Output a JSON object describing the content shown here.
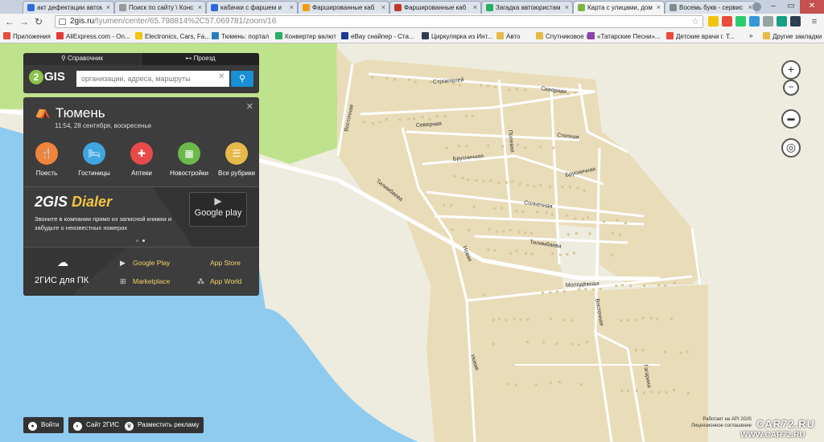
{
  "browser": {
    "tabs": [
      {
        "label": "акт дефектации автом",
        "fav_color": "#2d6bd6"
      },
      {
        "label": "Поиск по сайту \\ Конс",
        "fav_color": "#999999"
      },
      {
        "label": "кабачки с фаршем и",
        "fav_color": "#2d6bd6"
      },
      {
        "label": "Фаршированные каб",
        "fav_color": "#f39c12"
      },
      {
        "label": "Фаршированные каб",
        "fav_color": "#c0392b"
      },
      {
        "label": "Загадка автоюристам",
        "fav_color": "#27ae60"
      },
      {
        "label": "Карта с улицами, дом",
        "fav_color": "#7cb342"
      },
      {
        "label": "Восемь букв - сервис",
        "fav_color": "#7f8c8d"
      }
    ],
    "active_tab": 6,
    "url_host": "2gis.ru",
    "url_path": "/tyumen/center/65.798814%2C57.069781/zoom/16",
    "bookmarks": [
      {
        "label": "Приложения",
        "icon_color": "#e74c3c"
      },
      {
        "label": "AliExpress.com - On...",
        "icon_color": "#e53935"
      },
      {
        "label": "Electronics, Cars, Fa...",
        "icon_color": "#f1c40f"
      },
      {
        "label": "Тюмень: портал",
        "icon_color": "#2980b9"
      },
      {
        "label": "Конвертер валют",
        "icon_color": "#27ae60"
      },
      {
        "label": "eBay снайпер - Ста...",
        "icon_color": "#1e3799"
      },
      {
        "label": "Циркулярка из Инт...",
        "icon_color": "#2c3e50"
      },
      {
        "label": "Авто",
        "icon_color": "#e6b94a"
      },
      {
        "label": "Спутниковое тв",
        "icon_color": "#e6b94a"
      },
      {
        "label": "«Татарские Песни»...",
        "icon_color": "#8e44ad"
      },
      {
        "label": "Детские врачи г. Т...",
        "icon_color": "#e74c3c"
      },
      {
        "label": "Другие закладки",
        "icon_color": "#e6b94a"
      }
    ],
    "bookmarks_more": "»"
  },
  "panel": {
    "tab_directory": "Справочник",
    "tab_route": "Проезд",
    "logo_text": "GIS",
    "logo_digit": "2",
    "search_placeholder": "организации, адреса, маршруты",
    "city": "Тюмень",
    "datetime": "11:54, 28 сентября, воскресенье",
    "categories": [
      {
        "label": "Поесть",
        "icon": "fork-knife-icon",
        "color": "#f0843c",
        "glyph": "🍴"
      },
      {
        "label": "Гостиницы",
        "icon": "bed-icon",
        "color": "#3fa6e0",
        "glyph": "🛏"
      },
      {
        "label": "Аптеки",
        "icon": "cross-icon",
        "color": "#e84a4a",
        "glyph": "✚"
      },
      {
        "label": "Новостройки",
        "icon": "building-icon",
        "color": "#6cb84a",
        "glyph": "▦"
      },
      {
        "label": "Все рубрики",
        "icon": "list-icon",
        "color": "#e6b94a",
        "glyph": "☰"
      }
    ],
    "dialer_brand": "2GIS",
    "dialer_product": "Dialer",
    "dialer_text": "Звоните в компании прямо из записной книжки и забудьте о неизвестных номерах",
    "gplay_label": "Google play",
    "pc_label": "2ГИС для ПК",
    "stores": [
      {
        "label": "Google Play",
        "icon": "google-play-icon",
        "glyph": "▶"
      },
      {
        "label": "App Store",
        "icon": "apple-icon",
        "glyph": ""
      },
      {
        "label": "Marketplace",
        "icon": "windows-icon",
        "glyph": "⊞"
      },
      {
        "label": "App World",
        "icon": "blackberry-icon",
        "glyph": "⁂"
      }
    ]
  },
  "map": {
    "streets": [
      "Строителей",
      "Северная",
      "Северная",
      "Восточная",
      "Полевая",
      "Степная",
      "Брусничная",
      "Брусничная",
      "Солнечная",
      "Тилимбаева",
      "Тилимбаева",
      "Новая",
      "Новая",
      "Молодёжная",
      "Восточная",
      "Гагарина"
    ],
    "colors": {
      "water": "#8fcbee",
      "land": "#eeecde",
      "park": "#bfe28c",
      "village": "#e9dcb9",
      "road": "#ffffff"
    }
  },
  "controls": {
    "zoom_in": "+",
    "zoom_out": "−",
    "ruler": "▬",
    "locate": "◎"
  },
  "bottom": {
    "login": "Войти",
    "site": "Сайт 2ГИС",
    "ads": "Разместить рекламу"
  },
  "attribution": {
    "line1": "Работает на API 2GIS",
    "line2": "Лицензионное соглашение"
  },
  "watermark": {
    "line1": "CAR72.RU",
    "line2": "WWW.CAR72.RU"
  }
}
